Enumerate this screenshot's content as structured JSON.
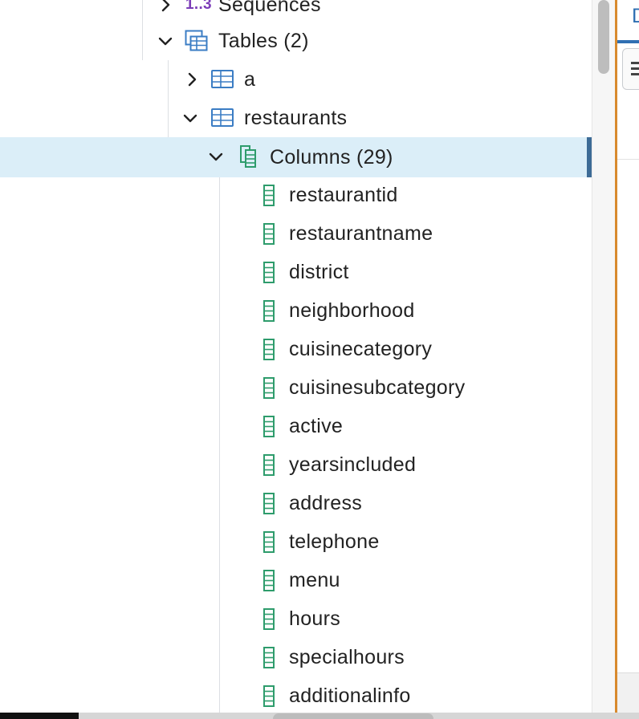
{
  "tree": {
    "sequences": {
      "number_badge": "1..3",
      "label": "Sequences"
    },
    "tables": {
      "label": "Tables (2)"
    },
    "table_a": {
      "label": "a"
    },
    "table_restaurants": {
      "label": "restaurants"
    },
    "columns_group": {
      "label": "Columns (29)"
    },
    "columns": [
      "restaurantid",
      "restaurantname",
      "district",
      "neighborhood",
      "cuisinecategory",
      "cuisinesubcategory",
      "active",
      "yearsincluded",
      "address",
      "telephone",
      "menu",
      "hours",
      "specialhours",
      "additionalinfo"
    ]
  },
  "right_panel": {
    "tab_partial": "D"
  },
  "colors": {
    "selection_bg": "#dbeef8",
    "selection_bar": "#3d6b96",
    "splitter": "#d88a2e",
    "table_icon": "#3b7dc4",
    "column_icon": "#2e9c6c",
    "sequence_badge": "#7c3db8",
    "tab_accent": "#2f6fb2"
  },
  "icons": {
    "sequence": "sequence-icon",
    "tables_group": "tables-group-icon",
    "table": "table-icon",
    "columns_group": "columns-group-icon",
    "column": "column-icon",
    "expand": "chevron-right-icon",
    "collapse": "chevron-down-icon"
  }
}
